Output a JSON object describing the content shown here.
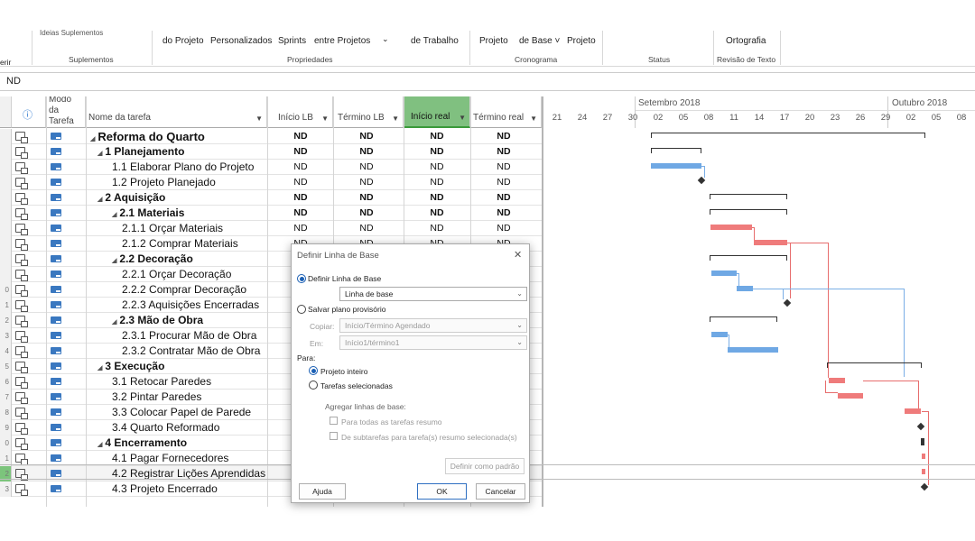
{
  "ribbon": {
    "items": [
      "erir",
      "Ideias Suplementos",
      "do Projeto",
      "Personalizados",
      "Sprints",
      "entre Projetos",
      "de Trabalho",
      "Projeto",
      "de Base",
      "Projeto",
      "Ortografia"
    ],
    "groups": [
      "Suplementos",
      "Propriedades",
      "Cronograma",
      "Status",
      "Revisão de Texto"
    ]
  },
  "formula_bar": {
    "value": "ND"
  },
  "columns": {
    "info": "ⓘ",
    "mode": "Modo da Tarefa",
    "name": "Nome da tarefa",
    "start_lb": "Início LB",
    "finish_lb": "Término LB",
    "start_actual": "Início real",
    "finish_actual": "Término real"
  },
  "tasks": [
    {
      "n": "",
      "name": "Reforma do Quarto",
      "level": 0,
      "summary": true,
      "v": [
        "ND",
        "ND",
        "ND",
        "ND"
      ]
    },
    {
      "n": "",
      "name": "1 Planejamento",
      "level": 1,
      "summary": true,
      "v": [
        "ND",
        "ND",
        "ND",
        "ND"
      ]
    },
    {
      "n": "",
      "name": "1.1 Elaborar Plano do Projeto",
      "level": 2,
      "summary": false,
      "v": [
        "ND",
        "ND",
        "ND",
        "ND"
      ]
    },
    {
      "n": "",
      "name": "1.2 Projeto Planejado",
      "level": 2,
      "summary": false,
      "v": [
        "ND",
        "ND",
        "ND",
        "ND"
      ]
    },
    {
      "n": "",
      "name": "2 Aquisição",
      "level": 1,
      "summary": true,
      "v": [
        "ND",
        "ND",
        "ND",
        "ND"
      ]
    },
    {
      "n": "",
      "name": "2.1 Materiais",
      "level": 2,
      "summary": true,
      "v": [
        "ND",
        "ND",
        "ND",
        "ND"
      ]
    },
    {
      "n": "",
      "name": "2.1.1 Orçar Materiais",
      "level": 3,
      "summary": false,
      "v": [
        "ND",
        "ND",
        "ND",
        "ND"
      ]
    },
    {
      "n": "",
      "name": "2.1.2 Comprar Materiais",
      "level": 3,
      "summary": false,
      "v": [
        "ND",
        "ND",
        "ND",
        "ND"
      ]
    },
    {
      "n": "",
      "name": "2.2 Decoração",
      "level": 2,
      "summary": true,
      "v": [
        "",
        "",
        "",
        ""
      ]
    },
    {
      "n": "",
      "name": "2.2.1 Orçar Decoração",
      "level": 3,
      "summary": false,
      "v": [
        "",
        "",
        "",
        ""
      ]
    },
    {
      "n": "0",
      "name": "2.2.2 Comprar Decoração",
      "level": 3,
      "summary": false,
      "v": [
        "",
        "",
        "",
        ""
      ]
    },
    {
      "n": "1",
      "name": "2.2.3 Aquisições Encerradas",
      "level": 3,
      "summary": false,
      "v": [
        "",
        "",
        "",
        ""
      ]
    },
    {
      "n": "2",
      "name": "2.3 Mão de Obra",
      "level": 2,
      "summary": true,
      "v": [
        "",
        "",
        "",
        ""
      ]
    },
    {
      "n": "3",
      "name": "2.3.1 Procurar Mão de Obra",
      "level": 3,
      "summary": false,
      "v": [
        "",
        "",
        "",
        ""
      ]
    },
    {
      "n": "4",
      "name": "2.3.2 Contratar Mão de Obra",
      "level": 3,
      "summary": false,
      "v": [
        "",
        "",
        "",
        ""
      ]
    },
    {
      "n": "5",
      "name": "3 Execução",
      "level": 1,
      "summary": true,
      "v": [
        "",
        "",
        "",
        ""
      ]
    },
    {
      "n": "6",
      "name": "3.1 Retocar Paredes",
      "level": 2,
      "summary": false,
      "v": [
        "",
        "",
        "",
        ""
      ]
    },
    {
      "n": "7",
      "name": "3.2 Pintar Paredes",
      "level": 2,
      "summary": false,
      "v": [
        "",
        "",
        "",
        ""
      ]
    },
    {
      "n": "8",
      "name": "3.3 Colocar Papel de Parede",
      "level": 2,
      "summary": false,
      "v": [
        "",
        "",
        "",
        ""
      ]
    },
    {
      "n": "9",
      "name": "3.4 Quarto Reformado",
      "level": 2,
      "summary": false,
      "v": [
        "",
        "",
        "",
        ""
      ]
    },
    {
      "n": "0",
      "name": "4 Encerramento",
      "level": 1,
      "summary": true,
      "v": [
        "",
        "",
        "",
        ""
      ]
    },
    {
      "n": "1",
      "name": "4.1 Pagar Fornecedores",
      "level": 2,
      "summary": false,
      "v": [
        "",
        "",
        "",
        ""
      ]
    },
    {
      "n": "2",
      "name": "4.2 Registrar Lições Aprendidas",
      "level": 2,
      "summary": false,
      "v": [
        "",
        "",
        "",
        ""
      ]
    },
    {
      "n": "3",
      "name": "4.3 Projeto Encerrado",
      "level": 2,
      "summary": false,
      "v": [
        "",
        "",
        "",
        ""
      ]
    }
  ],
  "timeline": {
    "months": [
      "Setembro 2018",
      "Outubro 2018"
    ],
    "days": [
      "21",
      "24",
      "27",
      "30",
      "02",
      "05",
      "08",
      "11",
      "14",
      "17",
      "20",
      "23",
      "26",
      "29",
      "02",
      "05",
      "08"
    ]
  },
  "dialog": {
    "title": "Definir Linha de Base",
    "close": "✕",
    "opt_set_baseline": "Definir Linha de Base",
    "baseline_select": "Linha de base",
    "opt_interim": "Salvar plano provisório",
    "copy_label": "Copiar:",
    "copy_value": "Início/Término Agendado",
    "into_label": "Em:",
    "into_value": "Início1/término1",
    "for_label": "Para:",
    "opt_entire": "Projeto inteiro",
    "opt_selected": "Tarefas selecionadas",
    "rollup_label": "Agregar linhas de base:",
    "chk_all_summary": "Para todas as tarefas resumo",
    "chk_from_subtasks": "De subtarefas para tarefa(s) resumo selecionada(s)",
    "btn_default": "Definir como padrão",
    "btn_help": "Ajuda",
    "btn_ok": "OK",
    "btn_cancel": "Cancelar"
  }
}
